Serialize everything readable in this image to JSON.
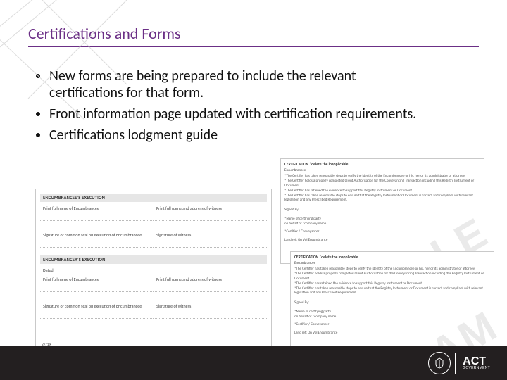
{
  "title": "Certifications and Forms",
  "bullets": [
    "New forms are being prepared to include the relevant certifications for that form.",
    "Front information page updated with certification requirements.",
    "Certifications lodgment guide"
  ],
  "left_form": {
    "section_a_title": "ENCUMBRANCEE'S EXECUTION",
    "name_label": "Print full name of Encumbrancee",
    "witness_name_label": "Print full name and address of witness",
    "sig_label": "Signature or common seal on execution of Encumbrancee",
    "witness_sig_label": "Signature of witness",
    "section_b_title": "ENCUMBRANCER'S EXECUTION",
    "dated_label": "Dated",
    "footer_left": "27/19"
  },
  "cert_blocks": {
    "head": "CERTIFICATION *delete the inapplicable",
    "subhead": "Encumbrancee",
    "lines": [
      "*The Certifier has taken reasonable steps to verify the identity of the Encumbrancee or his, her or its administrator or attorney.",
      "*The Certifier holds a properly completed Client Authorisation for the Conveyancing Transaction including this Registry Instrument or Document.",
      "*The Certifier has retained the evidence to support this Registry Instrument or Document.",
      "*The Certifier has taken reasonable steps to ensure that the Registry Instrument or Document is correct and compliant with relevant legislation and any Prescribed Requirement."
    ],
    "sig": "Signed By:",
    "name_of": "*Name of certifying party",
    "on_behalf": "on behalf of *company name",
    "who": "*Certifier / Conveyancer",
    "land_ref": "Land ref: On Vol Encumbrance"
  },
  "cert_blocks_b": {
    "subhead": "Encumbrancer"
  },
  "footer": {
    "logo_text": "ACT",
    "logo_sub": "GOVERNMENT"
  }
}
